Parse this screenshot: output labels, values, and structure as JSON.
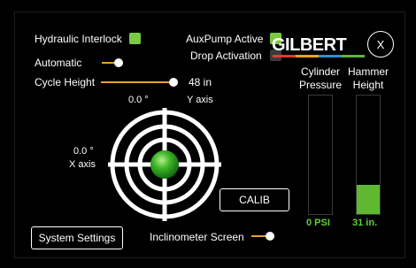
{
  "toggles": {
    "hydraulic_interlock": {
      "label": "Hydraulic Interlock",
      "state": "on"
    },
    "aux_pump": {
      "label": "AuxPump Active",
      "state": "on"
    },
    "drop_activation": {
      "label": "Drop Activation",
      "state": "off"
    },
    "automatic": {
      "label": "Automatic"
    }
  },
  "cycle_height": {
    "label": "Cycle Height",
    "value": "48 in"
  },
  "logo": {
    "text": "GILBERT"
  },
  "close_button": {
    "label": "X"
  },
  "target": {
    "x_value": "0.0 °",
    "x_label": "X axis",
    "y_value": "0.0 °",
    "y_label": "Y axis"
  },
  "calib_button": {
    "label": "CALIB"
  },
  "cylinder_pressure": {
    "label_line1": "Cylinder",
    "label_line2": "Pressure",
    "value": "0 PSI",
    "fill_fraction": 0.0
  },
  "hammer_height": {
    "label_line1": "Hammer",
    "label_line2": "Height",
    "value": "31 in.",
    "fill_fraction": 0.25
  },
  "system_settings_button": {
    "label": "System Settings"
  },
  "inclinometer": {
    "label": "Inclinometer Screen"
  },
  "colors": {
    "accent_orange": "#e8a02e",
    "led_green": "#7ac943",
    "led_off": "#3a3a3a",
    "gauge_green": "#5fb830",
    "logo_stripe": [
      "#e23b2e",
      "#f0a020",
      "#2e8fd6",
      "#5fb830"
    ]
  }
}
